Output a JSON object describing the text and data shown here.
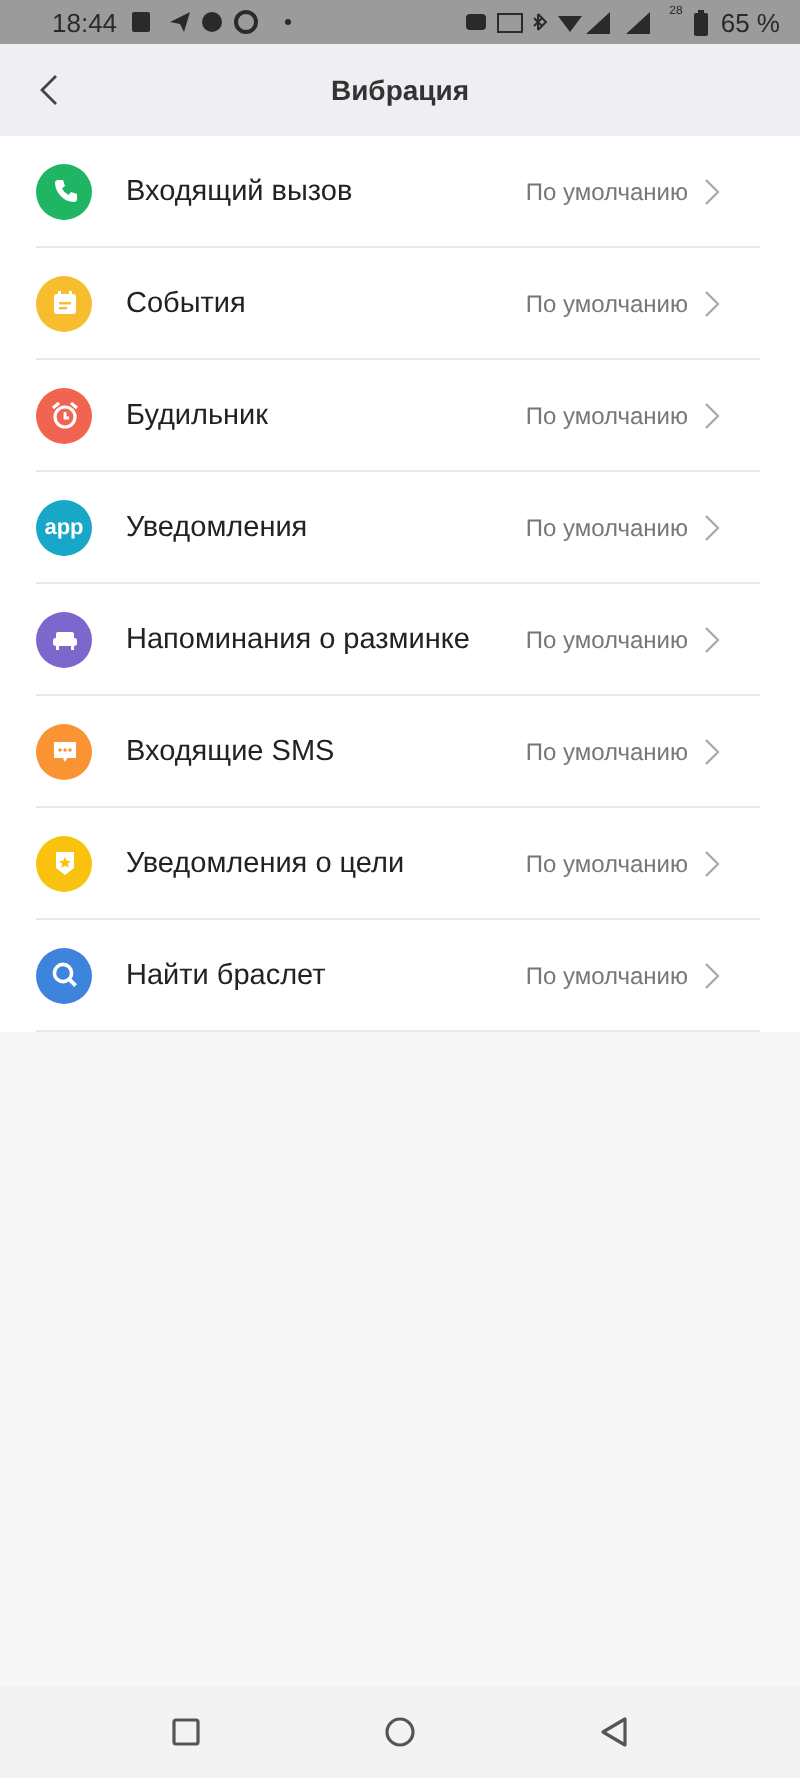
{
  "status_bar": {
    "time": "18:44",
    "network_label": "28",
    "battery": "65 %"
  },
  "header": {
    "title": "Вибрация"
  },
  "items": [
    {
      "label": "Входящий вызов",
      "value": "По умолчанию",
      "kind": "phone",
      "color": "#20b565"
    },
    {
      "label": "События",
      "value": "По умолчанию",
      "kind": "calendar",
      "color": "#f7bd2f"
    },
    {
      "label": "Будильник",
      "value": "По умолчанию",
      "kind": "alarm",
      "color": "#f26452"
    },
    {
      "label": "Уведомления",
      "value": "По умолчанию",
      "kind": "app",
      "color": "#18a6c9",
      "icon_text": "app"
    },
    {
      "label": "Напоминания о разминке",
      "value": "По умолчанию",
      "kind": "sofa",
      "color": "#7c67cc"
    },
    {
      "label": "Входящие SMS",
      "value": "По умолчанию",
      "kind": "chat",
      "color": "#f99333"
    },
    {
      "label": "Уведомления о цели",
      "value": "По умолчанию",
      "kind": "badge",
      "color": "#f9c20f"
    },
    {
      "label": "Найти браслет",
      "value": "По умолчанию",
      "kind": "search",
      "color": "#3e83dc"
    }
  ]
}
